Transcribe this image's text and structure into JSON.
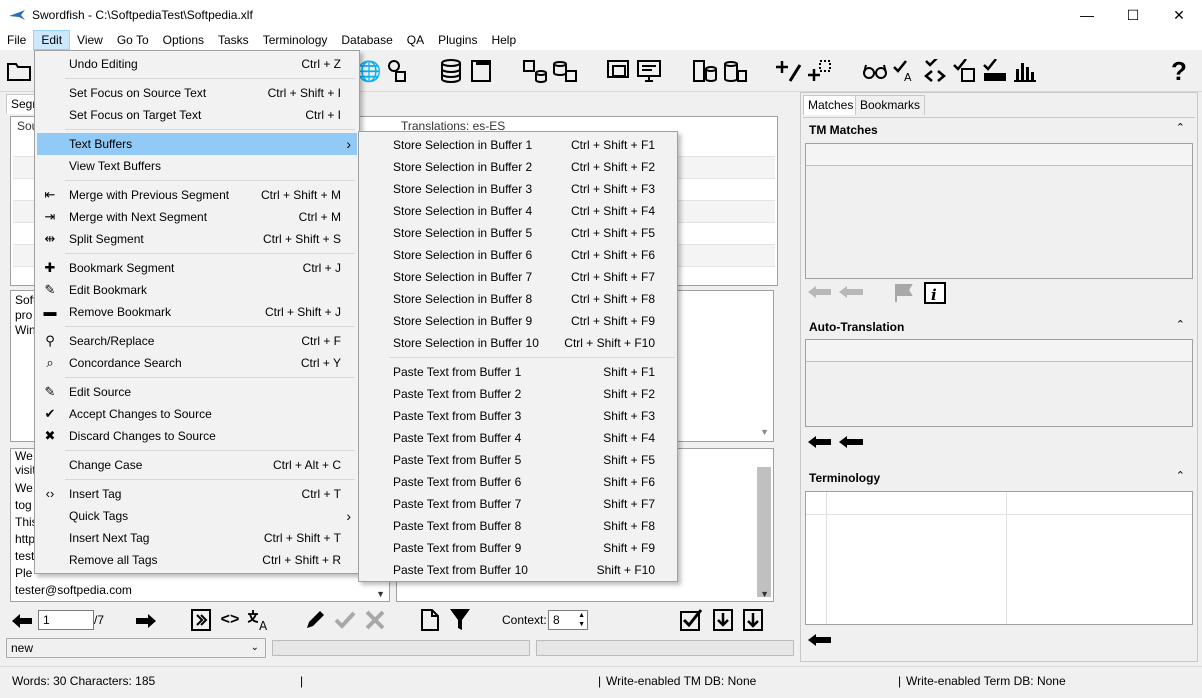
{
  "window": {
    "title": "Swordfish - C:\\SoftpediaTest\\Softpedia.xlf",
    "controls": {
      "minimize": "—",
      "maximize": "☐",
      "close": "✕"
    }
  },
  "menubar": [
    "File",
    "Edit",
    "View",
    "Go To",
    "Options",
    "Tasks",
    "Terminology",
    "Database",
    "QA",
    "Plugins",
    "Help"
  ],
  "left_panel": {
    "tab_label": "Segm",
    "source_header": "Sou",
    "translations_label": "Translations: es-ES",
    "source_text_lines": [
      "Soft",
      "pro",
      "Win"
    ],
    "segment_lines": [
      "We",
      "visit",
      "We",
      "tog",
      "This",
      "http",
      "test",
      "Ple",
      "tester@softpedia.com"
    ]
  },
  "right_panel": {
    "tabs": [
      "Matches",
      "Bookmarks"
    ],
    "sections": {
      "tm_matches": "TM Matches",
      "auto_translation": "Auto-Translation",
      "terminology": "Terminology"
    }
  },
  "navigation": {
    "current_page": "1",
    "total_pages": "/7",
    "context_label": "Context:",
    "context_value": "8",
    "status_value": "new"
  },
  "statusbar": {
    "counts": "Words: 30 Characters: 185",
    "tm_db": "Write-enabled TM DB: None",
    "term_db": "Write-enabled Term DB: None"
  },
  "edit_menu": [
    {
      "label": "Undo Editing",
      "shortcut": "Ctrl + Z",
      "icon": ""
    },
    {
      "sep": true
    },
    {
      "label": "Set Focus on Source Text",
      "shortcut": "Ctrl + Shift + I",
      "icon": ""
    },
    {
      "label": "Set Focus on Target Text",
      "shortcut": "Ctrl + I",
      "icon": ""
    },
    {
      "sep": true
    },
    {
      "label": "Text Buffers",
      "shortcut": "",
      "icon": "",
      "submenu": true,
      "highlighted": true
    },
    {
      "label": "View Text Buffers",
      "shortcut": "",
      "icon": ""
    },
    {
      "sep": true
    },
    {
      "label": "Merge with Previous Segment",
      "shortcut": "Ctrl + Shift + M",
      "icon": "merge-prev-icon"
    },
    {
      "label": "Merge with Next Segment",
      "shortcut": "Ctrl + M",
      "icon": "merge-next-icon"
    },
    {
      "label": "Split Segment",
      "shortcut": "Ctrl + Shift + S",
      "icon": "split-icon"
    },
    {
      "sep": true
    },
    {
      "label": "Bookmark Segment",
      "shortcut": "Ctrl + J",
      "icon": "plus-icon"
    },
    {
      "label": "Edit Bookmark",
      "shortcut": "",
      "icon": "pencil-icon"
    },
    {
      "label": "Remove Bookmark",
      "shortcut": "Ctrl + Shift + J",
      "icon": "minus-icon"
    },
    {
      "sep": true
    },
    {
      "label": "Search/Replace",
      "shortcut": "Ctrl + F",
      "icon": "search-icon"
    },
    {
      "label": "Concordance Search",
      "shortcut": "Ctrl + Y",
      "icon": "concordance-icon"
    },
    {
      "sep": true
    },
    {
      "label": "Edit Source",
      "shortcut": "",
      "icon": "pencil-icon"
    },
    {
      "label": "Accept Changes to Source",
      "shortcut": "",
      "icon": "check-icon"
    },
    {
      "label": "Discard Changes to Source",
      "shortcut": "",
      "icon": "x-icon"
    },
    {
      "sep": true
    },
    {
      "label": "Change Case",
      "shortcut": "Ctrl + Alt + C",
      "icon": ""
    },
    {
      "sep": true
    },
    {
      "label": "Insert Tag",
      "shortcut": "Ctrl + T",
      "icon": "tag-icon"
    },
    {
      "label": "Quick Tags",
      "shortcut": "",
      "icon": "",
      "submenu": true
    },
    {
      "label": "Insert Next Tag",
      "shortcut": "Ctrl + Shift + T",
      "icon": ""
    },
    {
      "label": "Remove all Tags",
      "shortcut": "Ctrl + Shift + R",
      "icon": ""
    }
  ],
  "buffers_menu": [
    {
      "label": "Store Selection in Buffer 1",
      "shortcut": "Ctrl + Shift + F1"
    },
    {
      "label": "Store Selection in Buffer 2",
      "shortcut": "Ctrl + Shift + F2"
    },
    {
      "label": "Store Selection in Buffer 3",
      "shortcut": "Ctrl + Shift + F3"
    },
    {
      "label": "Store Selection in Buffer 4",
      "shortcut": "Ctrl + Shift + F4"
    },
    {
      "label": "Store Selection in Buffer 5",
      "shortcut": "Ctrl + Shift + F5"
    },
    {
      "label": "Store Selection in Buffer 6",
      "shortcut": "Ctrl + Shift + F6"
    },
    {
      "label": "Store Selection in Buffer 7",
      "shortcut": "Ctrl + Shift + F7"
    },
    {
      "label": "Store Selection in Buffer 8",
      "shortcut": "Ctrl + Shift + F8"
    },
    {
      "label": "Store Selection in Buffer 9",
      "shortcut": "Ctrl + Shift + F9"
    },
    {
      "label": "Store Selection in Buffer 10",
      "shortcut": "Ctrl + Shift + F10"
    },
    {
      "sep": true
    },
    {
      "label": "Paste Text from Buffer 1",
      "shortcut": "Shift + F1"
    },
    {
      "label": "Paste Text from Buffer 2",
      "shortcut": "Shift + F2"
    },
    {
      "label": "Paste Text from Buffer 3",
      "shortcut": "Shift + F3"
    },
    {
      "label": "Paste Text from Buffer 4",
      "shortcut": "Shift + F4"
    },
    {
      "label": "Paste Text from Buffer 5",
      "shortcut": "Shift + F5"
    },
    {
      "label": "Paste Text from Buffer 6",
      "shortcut": "Shift + F6"
    },
    {
      "label": "Paste Text from Buffer 7",
      "shortcut": "Shift + F7"
    },
    {
      "label": "Paste Text from Buffer 8",
      "shortcut": "Shift + F8"
    },
    {
      "label": "Paste Text from Buffer 9",
      "shortcut": "Shift + F9"
    },
    {
      "label": "Paste Text from Buffer 10",
      "shortcut": "Shift + F10"
    }
  ],
  "colors": {
    "menu_highlight": "#91c9f7",
    "active_menu": "#cce8ff"
  }
}
